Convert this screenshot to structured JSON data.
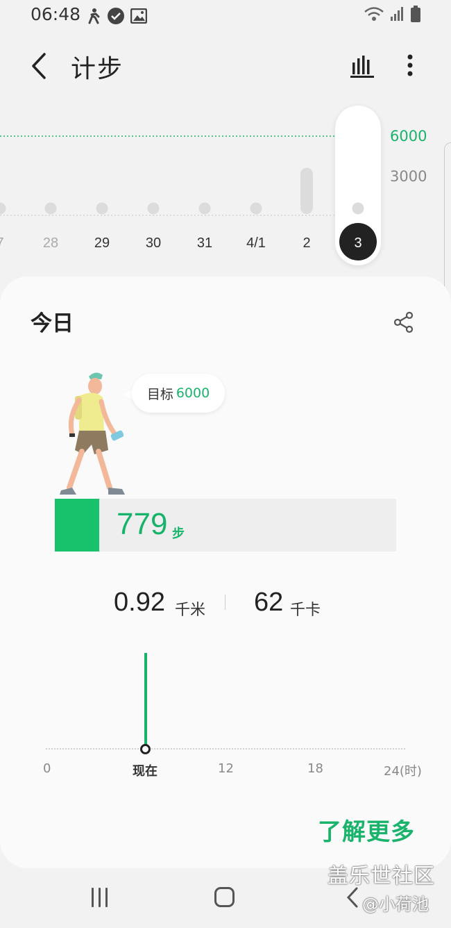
{
  "status_bar": {
    "time": "06:48",
    "left_icons": [
      "fitness-icon",
      "notification-icon",
      "image-icon"
    ],
    "right_icons": [
      "wifi-icon",
      "signal-icon",
      "battery-icon"
    ]
  },
  "app_bar": {
    "title": "计步",
    "icons": [
      "back-icon",
      "bar-chart-icon",
      "more-vert-icon"
    ]
  },
  "step_chart": {
    "goal_label": "6000",
    "mid_label": "3000",
    "selected_date": "3",
    "dates": [
      "7",
      "28",
      "29",
      "30",
      "31",
      "4/1",
      "2",
      "3"
    ],
    "colors": {
      "goal_line": "#19b36b",
      "dot": "#dcdcdc",
      "selected": "#222222"
    }
  },
  "chart_data": {
    "type": "bar",
    "categories": [
      "7",
      "28",
      "29",
      "30",
      "31",
      "4/1",
      "2",
      "3"
    ],
    "values": [
      0,
      0,
      0,
      0,
      0,
      0,
      779,
      779
    ],
    "ylim": [
      0,
      6000
    ],
    "goal": 6000,
    "ticks": [
      6000,
      3000
    ]
  },
  "today": {
    "title": "今日",
    "goal_prefix": "目标",
    "goal_value": "6000",
    "steps": "779",
    "steps_unit": "步",
    "steps_progress": 0.13,
    "distance": "0.92",
    "distance_unit": "千米",
    "calories": "62",
    "calories_unit": "千卡",
    "timeline": {
      "labels": [
        "0",
        "现在",
        "12",
        "18",
        "24(时)"
      ]
    },
    "learn_more": "了解更多",
    "colors": {
      "accent": "#19b36b",
      "bar_fill": "#18c26d",
      "track": "#eeeeee"
    }
  },
  "nav_bar": {
    "icons": [
      "recents-icon",
      "home-icon",
      "back-nav-icon"
    ]
  },
  "watermark": {
    "line1": "盖乐世社区",
    "line2": "@小荷池"
  }
}
